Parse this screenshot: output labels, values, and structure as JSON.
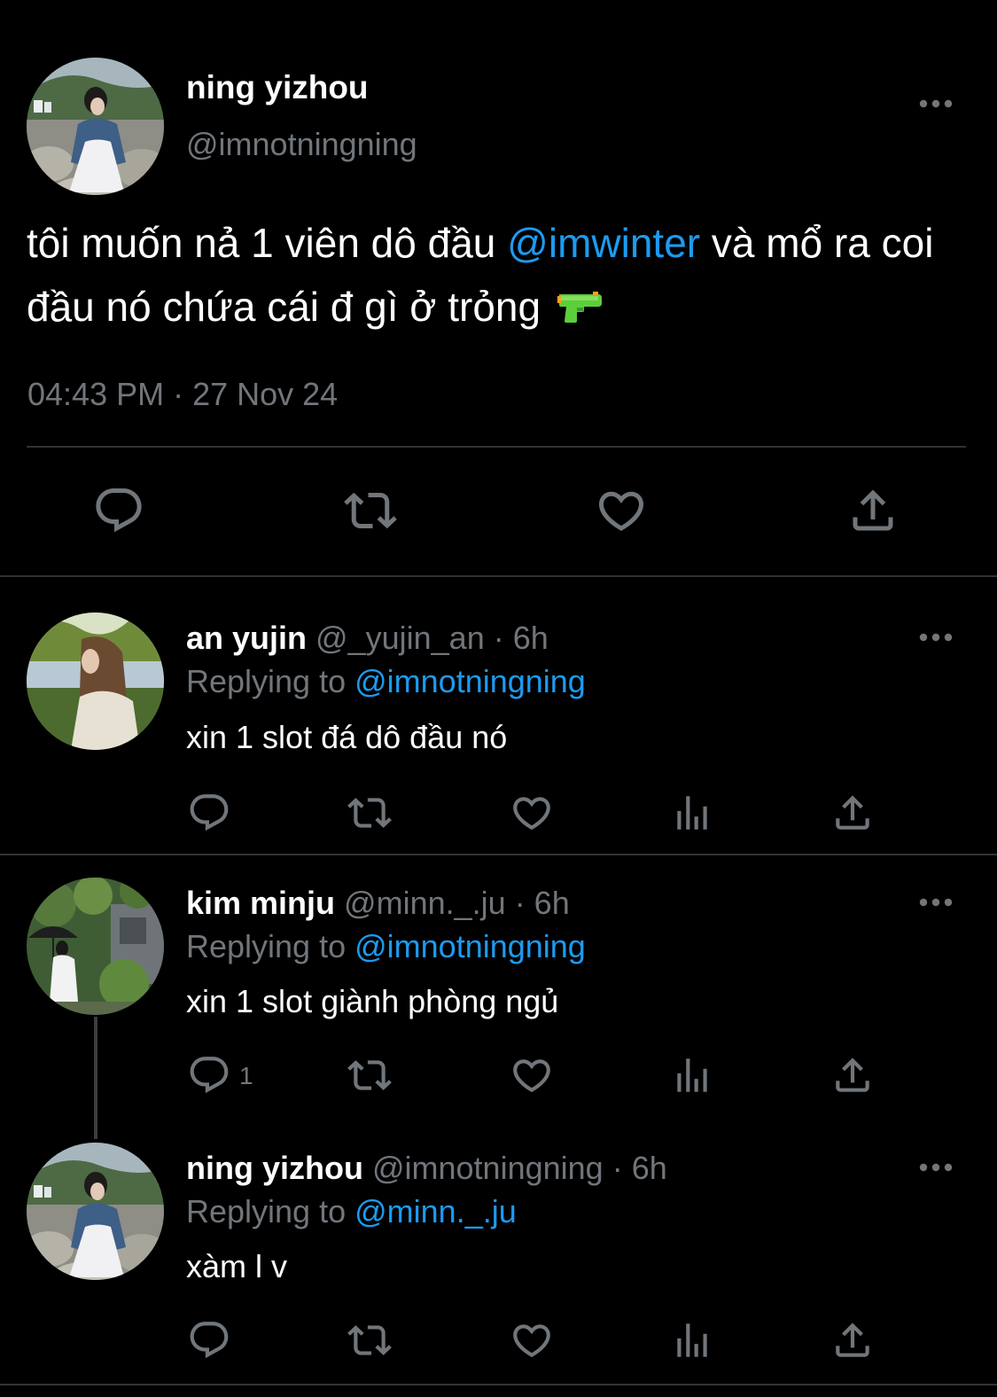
{
  "main_tweet": {
    "name": "ning yizhou",
    "handle": "@imnotningning",
    "text_before": "tôi muốn nả 1 viên dô đầu ",
    "mention": "@imwinter",
    "text_after": " và mổ ra coi đầu nó chứa cái đ gì ở trỏng ",
    "emoji": "water-pistol",
    "timestamp": "04:43 PM · 27 Nov 24",
    "actions": [
      "reply-icon",
      "retweet-icon",
      "like-icon",
      "share-icon"
    ]
  },
  "replies": [
    {
      "name": "an yujin",
      "handle": "@_yujin_an",
      "time": "· 6h",
      "replying_label": "Replying to",
      "replying_to": "@imnotningning",
      "text": "xin 1 slot đá dô đầu nó",
      "reply_count": "",
      "actions": [
        "reply-icon",
        "retweet-icon",
        "like-icon",
        "views-icon",
        "share-icon"
      ]
    },
    {
      "name": "kim minju",
      "handle": "@minn._.ju",
      "time": "· 6h",
      "replying_label": "Replying to",
      "replying_to": "@imnotningning",
      "text": "xin 1 slot giành phòng ngủ",
      "reply_count": "1",
      "actions": [
        "reply-icon",
        "retweet-icon",
        "like-icon",
        "views-icon",
        "share-icon"
      ]
    },
    {
      "name": "ning yizhou",
      "handle": "@imnotningning",
      "time": "· 6h",
      "replying_label": "Replying to",
      "replying_to": "@minn._.ju",
      "text": "xàm l v",
      "reply_count": "",
      "actions": [
        "reply-icon",
        "retweet-icon",
        "like-icon",
        "views-icon",
        "share-icon"
      ]
    }
  ],
  "colors": {
    "background": "#000000",
    "text": "#ffffff",
    "secondary": "#71767b",
    "accent": "#1d9bf0",
    "divider": "#2f3336"
  }
}
